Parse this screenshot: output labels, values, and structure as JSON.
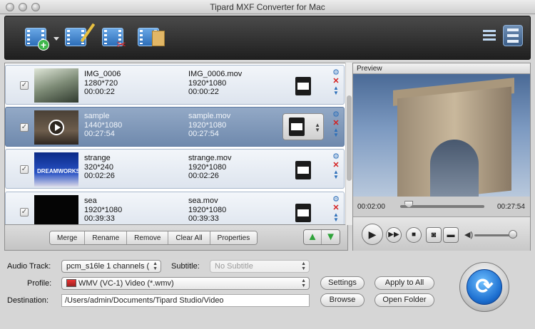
{
  "window": {
    "title": "Tipard MXF Converter for Mac"
  },
  "toolbar": {
    "add_file": "add-video-icon",
    "edit": "edit-wand-icon",
    "clip": "clip-scissors-icon",
    "snapshot": "snapshot-folder-icon",
    "view_list": "list-view-icon",
    "view_thumb": "thumbnail-view-icon"
  },
  "files": [
    {
      "src_name": "IMG_0006",
      "src_res": "1280*720",
      "src_dur": "00:00:22",
      "dst_name": "IMG_0006.mov",
      "dst_res": "1920*1080",
      "dst_dur": "00:00:22",
      "checked": true,
      "selected": false
    },
    {
      "src_name": "sample",
      "src_res": "1440*1080",
      "src_dur": "00:27:54",
      "dst_name": "sample.mov",
      "dst_res": "1920*1080",
      "dst_dur": "00:27:54",
      "checked": true,
      "selected": true
    },
    {
      "src_name": "strange",
      "src_res": "320*240",
      "src_dur": "00:02:26",
      "dst_name": "strange.mov",
      "dst_res": "1920*1080",
      "dst_dur": "00:02:26",
      "checked": true,
      "selected": false
    },
    {
      "src_name": "sea",
      "src_res": "1920*1080",
      "src_dur": "00:39:33",
      "dst_name": "sea.mov",
      "dst_res": "1920*1080",
      "dst_dur": "00:39:33",
      "checked": true,
      "selected": false
    }
  ],
  "actions": {
    "merge": "Merge",
    "rename": "Rename",
    "remove": "Remove",
    "clear_all": "Clear All",
    "properties": "Properties"
  },
  "preview": {
    "title": "Preview",
    "time_current": "00:02:00",
    "time_total": "00:27:54",
    "progress": 0.07,
    "volume": 0.9
  },
  "settings": {
    "audio_track_label": "Audio Track:",
    "audio_track_value": "pcm_s16le 1 channels (",
    "subtitle_label": "Subtitle:",
    "subtitle_value": "No Subtitle",
    "profile_label": "Profile:",
    "profile_value": "WMV (VC-1) Video (*.wmv)",
    "destination_label": "Destination:",
    "destination_value": "/Users/admin/Documents/Tipard Studio/Video",
    "settings_btn": "Settings",
    "apply_all_btn": "Apply to All",
    "browse_btn": "Browse",
    "open_folder_btn": "Open Folder"
  },
  "thumb_caption": "DREAMWORKS"
}
